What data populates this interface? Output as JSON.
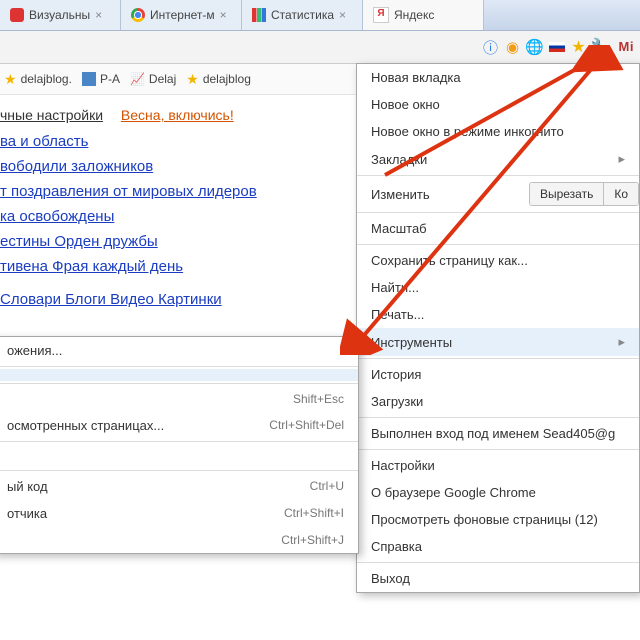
{
  "tabs": [
    {
      "label": "Визуальны",
      "icon": "shield"
    },
    {
      "label": "Интернет-м",
      "icon": "chrome"
    },
    {
      "label": "Статистика",
      "icon": "bars"
    },
    {
      "label": "Яндекс",
      "icon": "ya",
      "active": true
    }
  ],
  "toolbar_icons": [
    "info",
    "ball",
    "globe",
    "flag",
    "star",
    "wrench",
    "Mi"
  ],
  "bookmarks": [
    {
      "label": "delajblog.",
      "icon": "star"
    },
    {
      "label": "P-A",
      "icon": "sq"
    },
    {
      "label": "Delaj",
      "icon": "chart"
    },
    {
      "label": "delajblog",
      "icon": "star"
    }
  ],
  "subhdr": {
    "left": "чные настройки",
    "right": "Весна, включись!"
  },
  "news": [
    "ва и область",
    "вободили заложников",
    "т поздравления от мировых лидеров",
    "ка освобождены",
    "естины Орден дружбы",
    "тивена Фрая каждый день"
  ],
  "catrow": "Словари   Блоги   Видео   Картинки",
  "menu": {
    "items": [
      "Новая вкладка",
      "Новое окно",
      "Новое окно в режиме инкогнито",
      "Закладки",
      "__edit",
      "Масштаб",
      "Сохранить страницу как...",
      "Найти...",
      "Печать...",
      "Инструменты",
      "История",
      "Загрузки",
      "__signin",
      "Настройки",
      "О браузере Google Chrome",
      "Просмотреть фоновые страницы (12)",
      "Справка",
      "Выход"
    ],
    "edit_label": "Изменить",
    "edit_buttons": [
      "Вырезать",
      "Ко"
    ],
    "signin": "Выполнен вход под именем Sead405@g"
  },
  "submenu": {
    "top": "ожения...",
    "rows": [
      {
        "label": "",
        "sc": "Shift+Esc"
      },
      {
        "label": "осмотренных страницах...",
        "sc": "Ctrl+Shift+Del"
      },
      {
        "label": "",
        "sc": ""
      },
      {
        "label": "",
        "sc": ""
      },
      {
        "label": "ый код",
        "sc": "Ctrl+U"
      },
      {
        "label": "отчика",
        "sc": "Ctrl+Shift+I"
      },
      {
        "label": "",
        "sc": "Ctrl+Shift+J"
      }
    ]
  }
}
